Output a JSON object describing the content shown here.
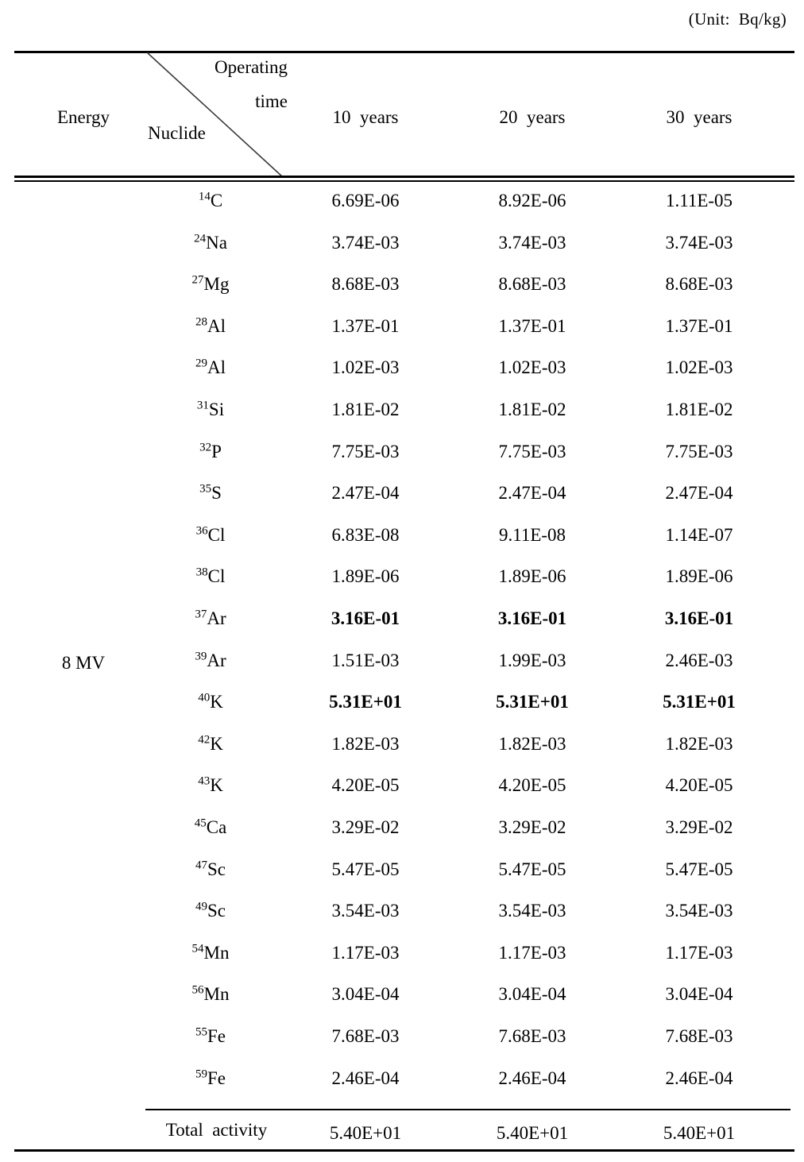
{
  "caption": {
    "unit": "(Unit:  Bq/kg)"
  },
  "header": {
    "energy_label": "Energy",
    "operating_line1": "Operating",
    "operating_line2": "time",
    "nuclide_label": "Nuclide",
    "columns": [
      "10  years",
      "20  years",
      "30  years"
    ]
  },
  "energy": {
    "value": "8 MV"
  },
  "total": {
    "label": "Total  activity",
    "values": [
      "5.40E+01",
      "5.40E+01",
      "5.40E+01"
    ]
  },
  "chart_data": {
    "type": "table",
    "title": "Activation nuclide activity concentrations at 8 MV",
    "unit": "Bq/kg",
    "row_group_label": "8 MV",
    "columns": [
      "Nuclide",
      "10  years",
      "20  years",
      "30  years"
    ],
    "rows": [
      {
        "mass": "14",
        "element": "C",
        "values": [
          "6.69E-06",
          "8.92E-06",
          "1.11E-05"
        ],
        "bold": false
      },
      {
        "mass": "24",
        "element": "Na",
        "values": [
          "3.74E-03",
          "3.74E-03",
          "3.74E-03"
        ],
        "bold": false
      },
      {
        "mass": "27",
        "element": "Mg",
        "values": [
          "8.68E-03",
          "8.68E-03",
          "8.68E-03"
        ],
        "bold": false
      },
      {
        "mass": "28",
        "element": "Al",
        "values": [
          "1.37E-01",
          "1.37E-01",
          "1.37E-01"
        ],
        "bold": false
      },
      {
        "mass": "29",
        "element": "Al",
        "values": [
          "1.02E-03",
          "1.02E-03",
          "1.02E-03"
        ],
        "bold": false
      },
      {
        "mass": "31",
        "element": "Si",
        "values": [
          "1.81E-02",
          "1.81E-02",
          "1.81E-02"
        ],
        "bold": false
      },
      {
        "mass": "32",
        "element": "P",
        "values": [
          "7.75E-03",
          "7.75E-03",
          "7.75E-03"
        ],
        "bold": false
      },
      {
        "mass": "35",
        "element": "S",
        "values": [
          "2.47E-04",
          "2.47E-04",
          "2.47E-04"
        ],
        "bold": false
      },
      {
        "mass": "36",
        "element": "Cl",
        "values": [
          "6.83E-08",
          "9.11E-08",
          "1.14E-07"
        ],
        "bold": false
      },
      {
        "mass": "38",
        "element": "Cl",
        "values": [
          "1.89E-06",
          "1.89E-06",
          "1.89E-06"
        ],
        "bold": false
      },
      {
        "mass": "37",
        "element": "Ar",
        "values": [
          "3.16E-01",
          "3.16E-01",
          "3.16E-01"
        ],
        "bold": true
      },
      {
        "mass": "39",
        "element": "Ar",
        "values": [
          "1.51E-03",
          "1.99E-03",
          "2.46E-03"
        ],
        "bold": false
      },
      {
        "mass": "40",
        "element": "K",
        "values": [
          "5.31E+01",
          "5.31E+01",
          "5.31E+01"
        ],
        "bold": true
      },
      {
        "mass": "42",
        "element": "K",
        "values": [
          "1.82E-03",
          "1.82E-03",
          "1.82E-03"
        ],
        "bold": false
      },
      {
        "mass": "43",
        "element": "K",
        "values": [
          "4.20E-05",
          "4.20E-05",
          "4.20E-05"
        ],
        "bold": false
      },
      {
        "mass": "45",
        "element": "Ca",
        "values": [
          "3.29E-02",
          "3.29E-02",
          "3.29E-02"
        ],
        "bold": false
      },
      {
        "mass": "47",
        "element": "Sc",
        "values": [
          "5.47E-05",
          "5.47E-05",
          "5.47E-05"
        ],
        "bold": false
      },
      {
        "mass": "49",
        "element": "Sc",
        "values": [
          "3.54E-03",
          "3.54E-03",
          "3.54E-03"
        ],
        "bold": false
      },
      {
        "mass": "54",
        "element": "Mn",
        "values": [
          "1.17E-03",
          "1.17E-03",
          "1.17E-03"
        ],
        "bold": false
      },
      {
        "mass": "56",
        "element": "Mn",
        "values": [
          "3.04E-04",
          "3.04E-04",
          "3.04E-04"
        ],
        "bold": false
      },
      {
        "mass": "55",
        "element": "Fe",
        "values": [
          "7.68E-03",
          "7.68E-03",
          "7.68E-03"
        ],
        "bold": false
      },
      {
        "mass": "59",
        "element": "Fe",
        "values": [
          "2.46E-04",
          "2.46E-04",
          "2.46E-04"
        ],
        "bold": false
      }
    ],
    "total_row": {
      "label": "Total  activity",
      "values": [
        "5.40E+01",
        "5.40E+01",
        "5.40E+01"
      ]
    }
  }
}
